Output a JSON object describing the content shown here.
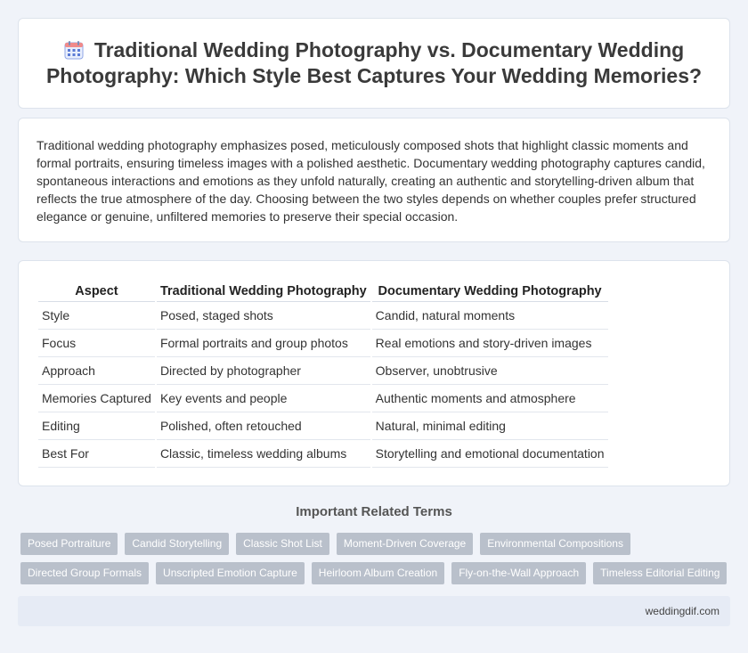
{
  "header": {
    "icon": "calendar-icon",
    "title": "Traditional Wedding Photography vs. Documentary Wedding Photography: Which Style Best Captures Your Wedding Memories?"
  },
  "intro": {
    "text": "Traditional wedding photography emphasizes posed, meticulously composed shots that highlight classic moments and formal portraits, ensuring timeless images with a polished aesthetic. Documentary wedding photography captures candid, spontaneous interactions and emotions as they unfold naturally, creating an authentic and storytelling-driven album that reflects the true atmosphere of the day. Choosing between the two styles depends on whether couples prefer structured elegance or genuine, unfiltered memories to preserve their special occasion."
  },
  "table": {
    "headers": [
      "Aspect",
      "Traditional Wedding Photography",
      "Documentary Wedding Photography"
    ],
    "rows": [
      [
        "Style",
        "Posed, staged shots",
        "Candid, natural moments"
      ],
      [
        "Focus",
        "Formal portraits and group photos",
        "Real emotions and story-driven images"
      ],
      [
        "Approach",
        "Directed by photographer",
        "Observer, unobtrusive"
      ],
      [
        "Memories Captured",
        "Key events and people",
        "Authentic moments and atmosphere"
      ],
      [
        "Editing",
        "Polished, often retouched",
        "Natural, minimal editing"
      ],
      [
        "Best For",
        "Classic, timeless wedding albums",
        "Storytelling and emotional documentation"
      ]
    ]
  },
  "terms": {
    "title": "Important Related Terms",
    "tags": [
      "Posed Portraiture",
      "Candid Storytelling",
      "Classic Shot List",
      "Moment-Driven Coverage",
      "Environmental Compositions",
      "Directed Group Formals",
      "Unscripted Emotion Capture",
      "Heirloom Album Creation",
      "Fly-on-the-Wall Approach",
      "Timeless Editorial Editing"
    ]
  },
  "footer": {
    "site": "weddingdif.com"
  },
  "colors": {
    "background": "#f0f3f9",
    "tag": "#b9c0cb",
    "footer": "#e6ebf5",
    "icon_accent": "#5b7bd5"
  }
}
